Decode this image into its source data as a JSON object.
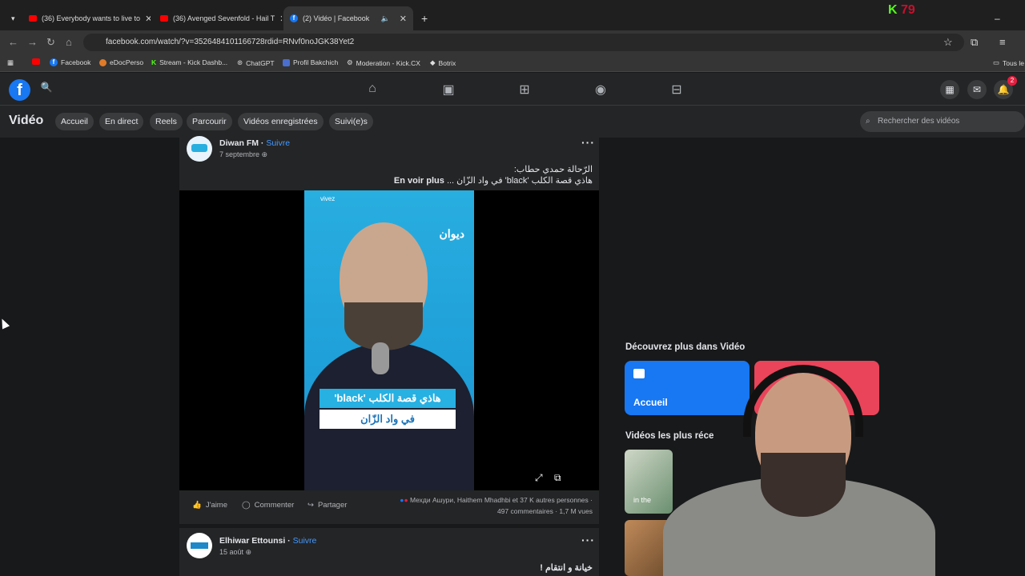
{
  "browser": {
    "tabs": [
      {
        "label": "(36) Everybody wants to live to",
        "kind": "youtube"
      },
      {
        "label": "(36) Avenged Sevenfold - Hail T",
        "kind": "youtube"
      },
      {
        "label": "(2) Vidéo | Facebook",
        "kind": "facebook"
      }
    ],
    "url": "facebook.com/watch/?v=3526484101166728rdid=RNvf0noJGK38Yet2",
    "bookmarks": [
      "Facebook",
      "eDocPerso",
      "Stream - Kick Dashb...",
      "ChatGPT",
      "Profil Bakchich",
      "Moderation - Kick.CX",
      "Botrix"
    ],
    "bookmarks_right": "Tous le",
    "kick_number": "79"
  },
  "fb": {
    "notification_count": "2"
  },
  "video_nav": {
    "title": "Vidéo",
    "chips": [
      "Accueil",
      "En direct",
      "Reels",
      "Parcourir",
      "Vidéos enregistrées",
      "Suivi(e)s"
    ],
    "search_placeholder": "Rechercher des vidéos"
  },
  "post1": {
    "author": "Diwan FM",
    "follow": "Suivre",
    "date": "7 septembre",
    "text_line1": "الرّحالة حمدي حطاب:",
    "text_line2": "هاذي قصة الكلب 'black' في واد الزّان ...",
    "see_more": "En voir plus",
    "video_brand_top": "vivez",
    "video_brand": "ديوان",
    "caption1": "هاذي قصة الكلب 'black'",
    "caption2": "في واد الزّان",
    "like": "J'aime",
    "comment": "Commenter",
    "share": "Partager",
    "reactions": "Мехди Ашури, Haithem Mhadhbi et 37 K autres personnes",
    "comments_count": "497 commentaires",
    "views": "1,7 M vues"
  },
  "post2": {
    "author": "Elhiwar Ettounsi",
    "follow": "Suivre",
    "date": "15 août",
    "text": "خيانة و انتقام !"
  },
  "sidebar": {
    "discover_title": "Découvrez plus dans Vidéo",
    "card_home": "Accueil",
    "recent_title": "Vidéos les plus réce",
    "thumb_text": "in the"
  },
  "colors": {
    "fb_blue": "#1877f2",
    "follow_blue": "#4599ff",
    "kick_green": "#53fc18"
  }
}
